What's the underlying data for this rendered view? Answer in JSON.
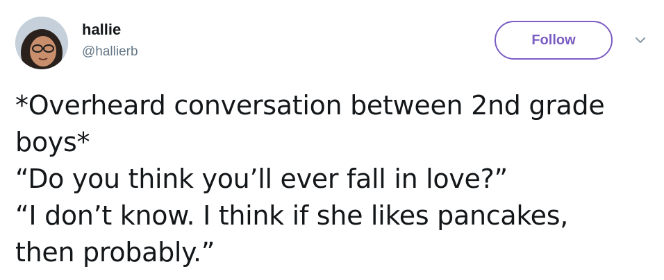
{
  "user": {
    "display_name": "hallie",
    "handle": "@hallierb"
  },
  "actions": {
    "follow_label": "Follow",
    "caret_icon": "chevron-down-icon"
  },
  "colors": {
    "accent": "#7a5cc2",
    "handle": "#657786",
    "text": "#14171a"
  },
  "tweet": {
    "lines": [
      "*Overheard conversation between 2nd grade",
      "boys*",
      "“Do you think you’ll ever fall in love?”",
      "“I don’t know. I think if she likes pancakes,",
      "then probably.”"
    ]
  }
}
